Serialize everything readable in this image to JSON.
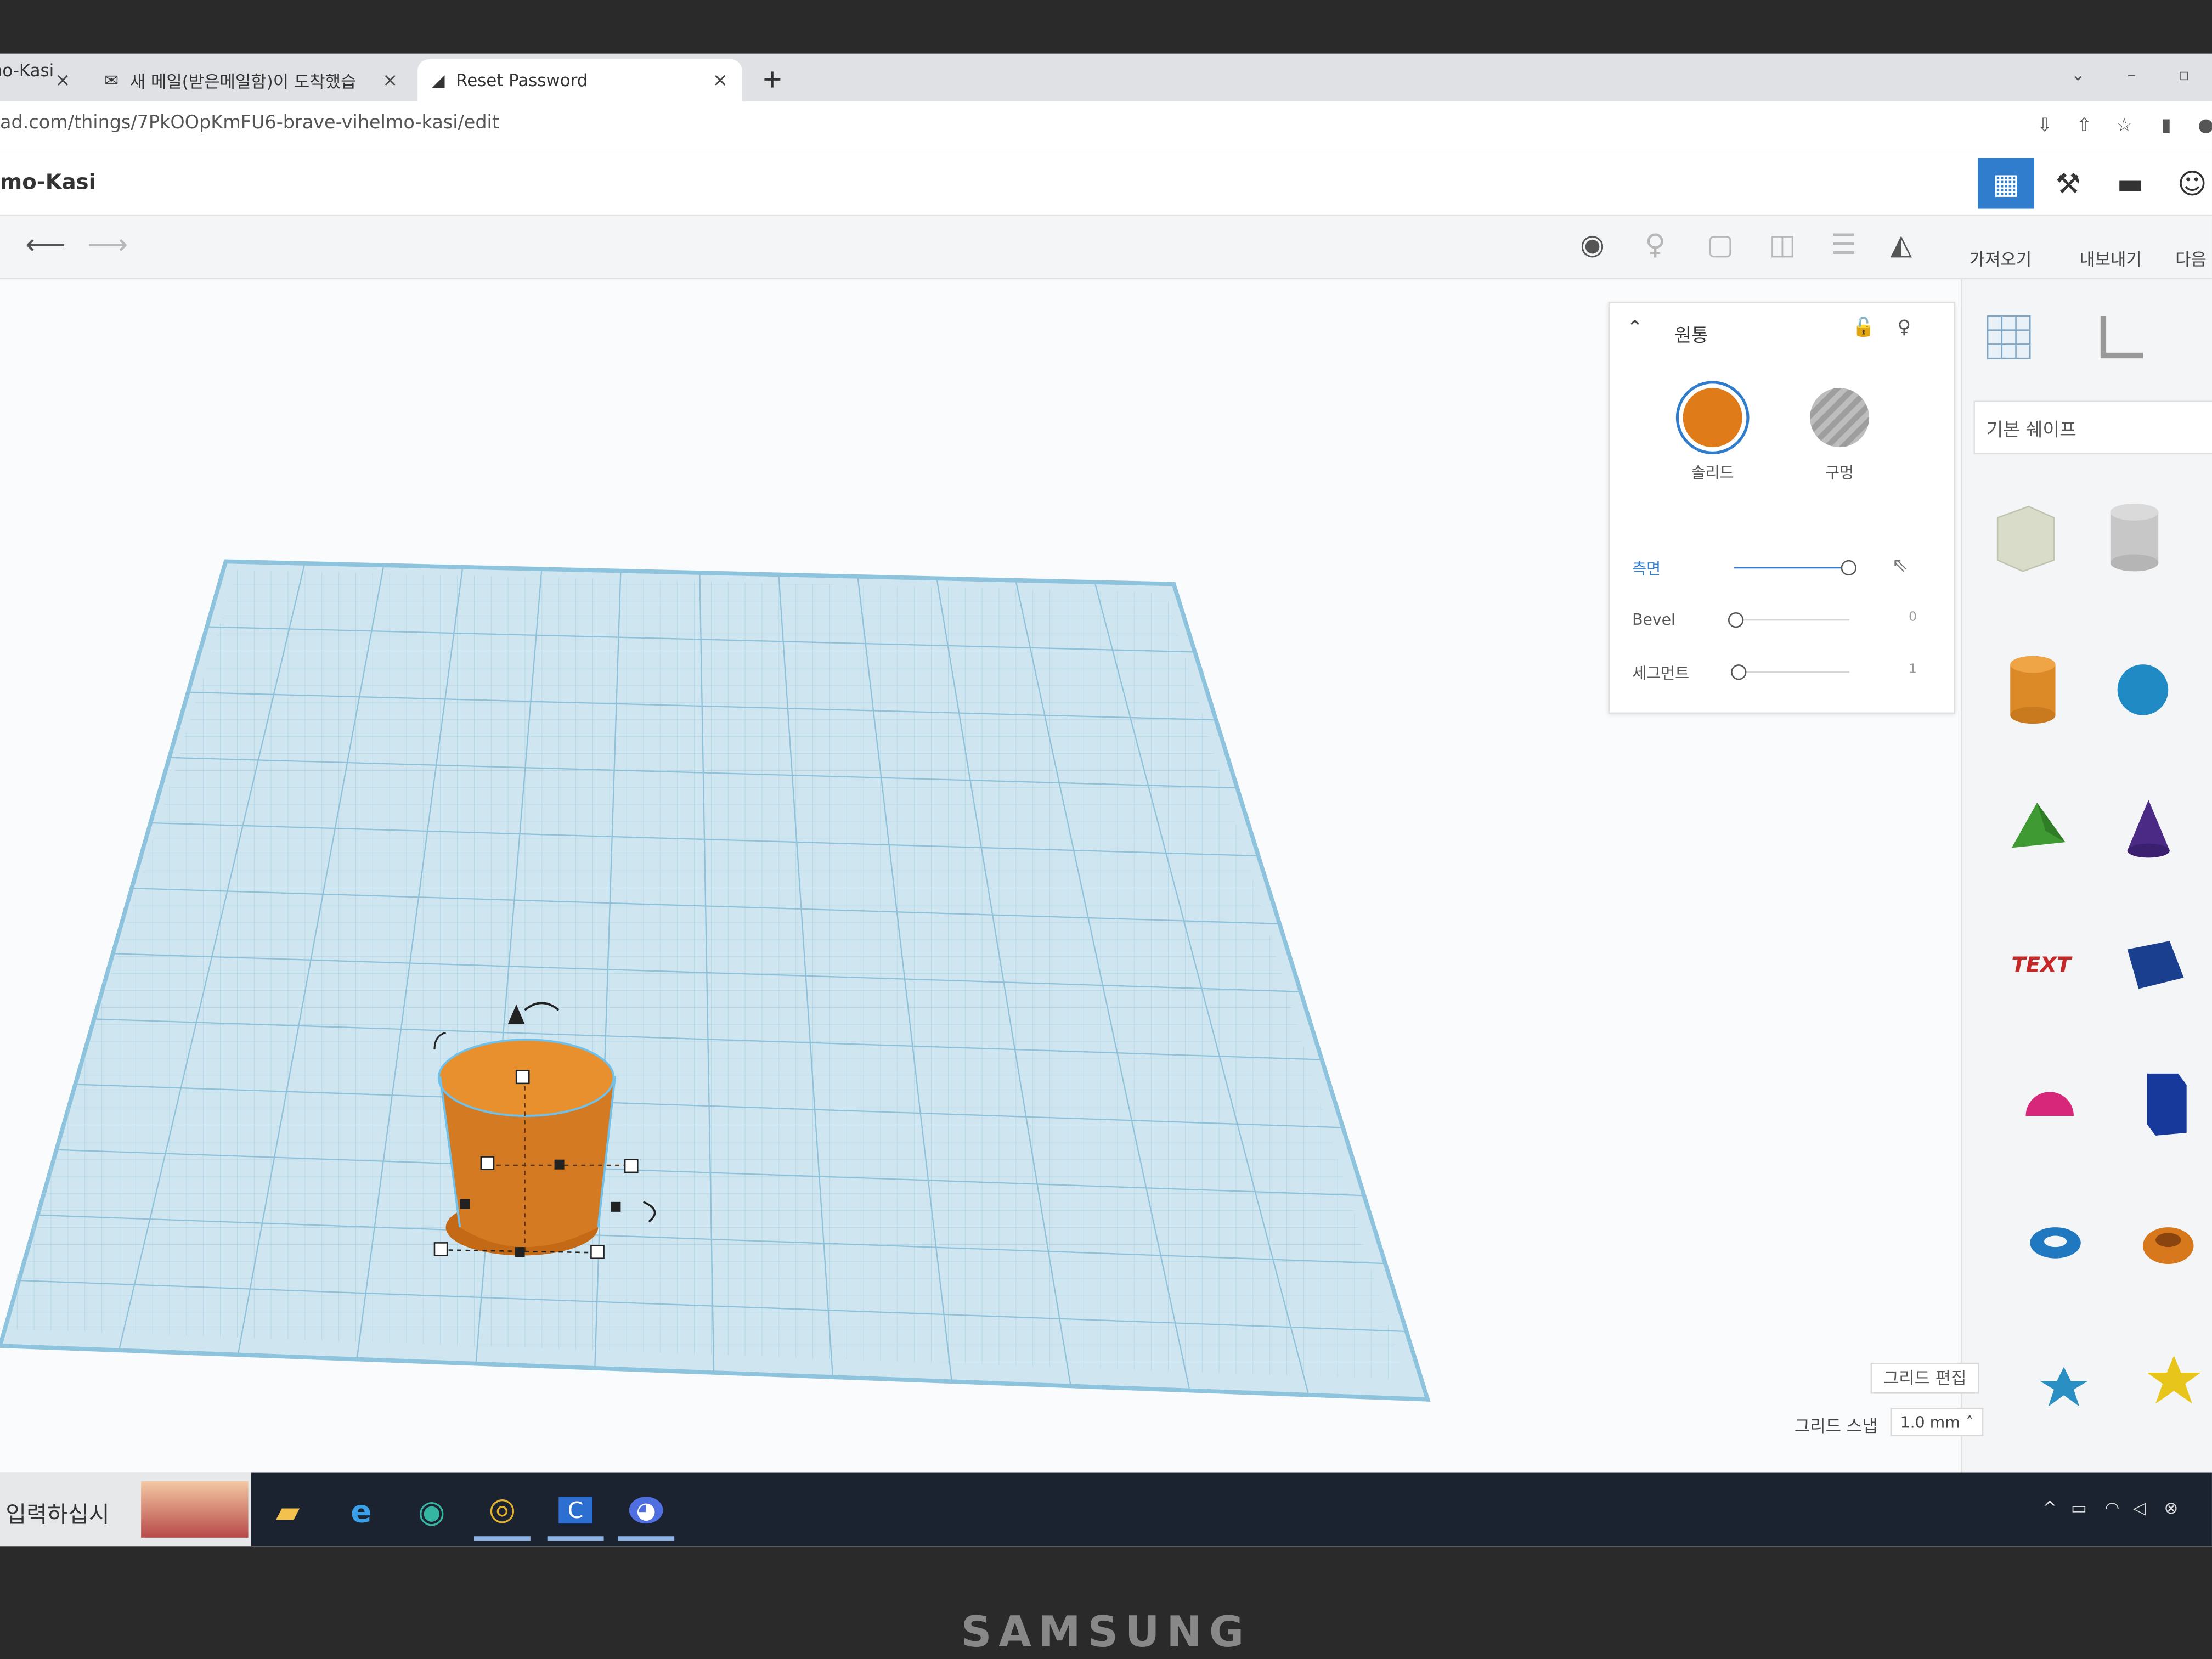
{
  "browser": {
    "tabs": [
      {
        "label": "mo-Kasi |",
        "active": false
      },
      {
        "label": "새 메일(받은메일함)이 도착했습",
        "active": false
      },
      {
        "label": "Reset Password",
        "active": true
      }
    ],
    "new_tab_label": "+",
    "close_glyph": "×",
    "url": "ad.com/things/7PkOOpKmFU6-brave-vihelmo-kasi/edit"
  },
  "app": {
    "title": "mo-Kasi",
    "header_buttons": [
      "grid-view-icon",
      "pickaxe-icon",
      "bricks-icon",
      "user-add-icon"
    ]
  },
  "toolbar": {
    "import_label": "가져오기",
    "export_label": "내보내기",
    "next_label": "다음",
    "undo_glyph": "⟵",
    "redo_glyph": "⟶"
  },
  "inspector": {
    "shape_name": "원통",
    "solid_label": "솔리드",
    "hole_label": "구멍",
    "solid_color": "#e07b1a",
    "properties": [
      {
        "label": "측면",
        "value": "",
        "level": 1.0
      },
      {
        "label": "Bevel",
        "value": "0",
        "level": 0.0
      },
      {
        "label": "세그먼트",
        "value": "1",
        "level": 0.0
      }
    ]
  },
  "library": {
    "category": "기본 쉐이프",
    "shapes": [
      "box-hole-shape",
      "cylinder-hole-shape",
      "cylinder-shape",
      "sphere-shape",
      "pyramid-shape",
      "cone-shape",
      "text-shape",
      "wedge-shape",
      "half-sphere-shape",
      "polygon-shape",
      "torus-shape",
      "tube-shape",
      "star-shape",
      "yellow-star-shape"
    ],
    "text_shape_label": "TEXT"
  },
  "bottom": {
    "grid_edit_label": "그리드 편집",
    "grid_snap_label": "그리드 스냅",
    "grid_snap_value": "1.0 mm"
  },
  "taskbar": {
    "search_text": "입력하십시",
    "apps": [
      "file-explorer-icon",
      "internet-explorer-icon",
      "edge-icon",
      "chrome-icon",
      "classting-icon",
      "game-icon"
    ]
  },
  "bezel_brand": "SAMSUNG",
  "colors": {
    "accent": "#2f7dcc",
    "workplane": "#cfe6f1",
    "cylinder": "#e07b1a"
  }
}
